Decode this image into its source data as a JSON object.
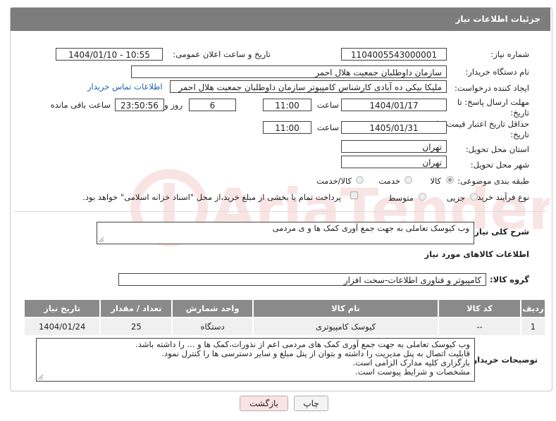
{
  "header": {
    "title": "جزئیات اطلاعات نیاز"
  },
  "fields": {
    "need_number_label": "شماره نیاز:",
    "need_number": "1104005543000001",
    "announce_label": "تاریخ و ساعت اعلان عمومی:",
    "announce_value": "1404/01/10 - 10:55",
    "buyer_org_label": "نام دستگاه خریدار:",
    "buyer_org": "سازمان داوطلبان جمعیت هلال احمر",
    "creator_label": "ایجاد کننده درخواست:",
    "creator": "ملیکا بیکی ده آبادی کارشناس کامپیوتر سازمان داوطلبان جمعیت هلال احمر",
    "contact_link": "اطلاعات تماس خریدار",
    "deadline_label_1": "مهلت ارسال پاسخ: تا",
    "deadline_label_2": "تاریخ:",
    "deadline_date": "1404/01/17",
    "time_label": "ساعت",
    "deadline_time": "11:00",
    "days_value": "6",
    "days_label": "روز و",
    "remaining_value": "23:50:56",
    "remaining_label": "ساعت باقی مانده",
    "validity_label_1": "حداقل تاریخ اعتبار قیمت: تا",
    "validity_label_2": "تاریخ:",
    "validity_date": "1405/01/31",
    "validity_time": "11:00",
    "province_label": "استان محل تحویل:",
    "province": "تهران",
    "city_label": "شهر محل تحویل:",
    "city": "تهران",
    "category_label": "طبقه بندی موضوعی:",
    "cat_goods": "کالا",
    "cat_service": "خدمت",
    "cat_both": "کالا/خدمت",
    "process_label": "نوع فرآیند خرید :",
    "proc_partial": "جزیی",
    "proc_medium": "متوسط",
    "payment_note": "پرداخت تمام یا بخشی از مبلغ خرید،از محل \"اسناد خزانه اسلامی\" خواهد بود."
  },
  "description": {
    "label": "شرح کلی نیاز:",
    "value": "وب کیوسک تعاملی به جهت جمع آوری کمک ها و ی مردمی"
  },
  "goods": {
    "section_title": "اطلاعات کالاهای مورد نیاز",
    "group_label": "گروه کالا:",
    "group_value": "کامپیوتر و فناوری اطلاعات-سخت افزار",
    "columns": [
      "ردیف",
      "کد کالا",
      "نام کالا",
      "واحد شمارش",
      "تعداد / مقدار",
      "تاریخ نیاز"
    ],
    "rows": [
      {
        "index": "1",
        "code": "--",
        "name": "کیوسک کامپیوتری",
        "unit": "دستگاه",
        "qty": "25",
        "date": "1404/01/24"
      }
    ]
  },
  "buyer_notes": {
    "label": "توضیحات خریدار:",
    "value": "وب کیوسک تعاملی به جهت جمع آوری کمک های مردمی اعم از نذورات،کمک ها و ... را داشته باشد.\nقابلیت اتصال به پنل مدیریت را داشته و بتوان از پنل مبلغ و سایر دسترسی ها را کنترل نمود.\nبارگزاری کلیه مدارک الزامی است.\nمشخصات و شرایط پیوست است."
  },
  "buttons": {
    "print": "چاپ",
    "back": "بازگشت"
  },
  "colors": {
    "header_bg": "#7d7d7d",
    "link": "#1a5fb4",
    "back_btn_bg": "#fbe3e3",
    "table_header": "#8a8a8a"
  }
}
